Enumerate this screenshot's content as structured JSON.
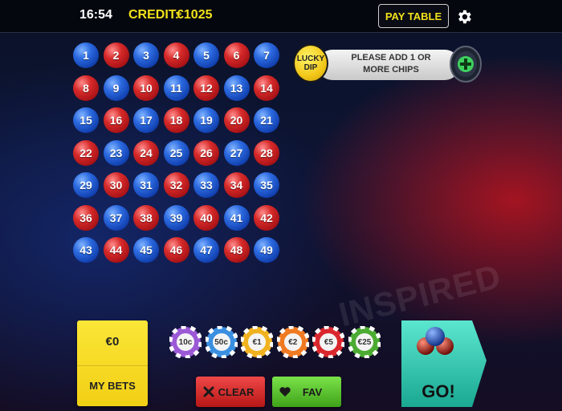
{
  "header": {
    "time": "16:54",
    "credit_label": "CREDIT:",
    "credit_value": "€1025",
    "paytable_label": "PAY TABLE",
    "settings_icon": "gear-icon"
  },
  "watermark": "INSPIRED",
  "colors": {
    "blue_ball": "#1f55cc",
    "red_ball": "#c81c1f",
    "accent_yellow": "#f2e21a",
    "clear_red": "#d92b2b",
    "fav_green": "#57c22d",
    "go_teal": "#2fc8b0"
  },
  "balls": [
    {
      "n": "1",
      "c": "blue"
    },
    {
      "n": "2",
      "c": "red"
    },
    {
      "n": "3",
      "c": "blue"
    },
    {
      "n": "4",
      "c": "red"
    },
    {
      "n": "5",
      "c": "blue"
    },
    {
      "n": "6",
      "c": "red"
    },
    {
      "n": "7",
      "c": "blue"
    },
    {
      "n": "8",
      "c": "red"
    },
    {
      "n": "9",
      "c": "blue"
    },
    {
      "n": "10",
      "c": "red"
    },
    {
      "n": "11",
      "c": "blue"
    },
    {
      "n": "12",
      "c": "red"
    },
    {
      "n": "13",
      "c": "blue"
    },
    {
      "n": "14",
      "c": "red"
    },
    {
      "n": "15",
      "c": "blue"
    },
    {
      "n": "16",
      "c": "red"
    },
    {
      "n": "17",
      "c": "blue"
    },
    {
      "n": "18",
      "c": "red"
    },
    {
      "n": "19",
      "c": "blue"
    },
    {
      "n": "20",
      "c": "red"
    },
    {
      "n": "21",
      "c": "blue"
    },
    {
      "n": "22",
      "c": "red"
    },
    {
      "n": "23",
      "c": "blue"
    },
    {
      "n": "24",
      "c": "red"
    },
    {
      "n": "25",
      "c": "blue"
    },
    {
      "n": "26",
      "c": "red"
    },
    {
      "n": "27",
      "c": "blue"
    },
    {
      "n": "28",
      "c": "red"
    },
    {
      "n": "29",
      "c": "blue"
    },
    {
      "n": "30",
      "c": "red"
    },
    {
      "n": "31",
      "c": "blue"
    },
    {
      "n": "32",
      "c": "red"
    },
    {
      "n": "33",
      "c": "blue"
    },
    {
      "n": "34",
      "c": "red"
    },
    {
      "n": "35",
      "c": "blue"
    },
    {
      "n": "36",
      "c": "red"
    },
    {
      "n": "37",
      "c": "blue"
    },
    {
      "n": "38",
      "c": "red"
    },
    {
      "n": "39",
      "c": "blue"
    },
    {
      "n": "40",
      "c": "red"
    },
    {
      "n": "41",
      "c": "blue"
    },
    {
      "n": "42",
      "c": "red"
    },
    {
      "n": "43",
      "c": "blue"
    },
    {
      "n": "44",
      "c": "red"
    },
    {
      "n": "45",
      "c": "blue"
    },
    {
      "n": "46",
      "c": "red"
    },
    {
      "n": "47",
      "c": "blue"
    },
    {
      "n": "48",
      "c": "red"
    },
    {
      "n": "49",
      "c": "blue"
    }
  ],
  "lucky_dip": {
    "badge_line1": "LUCKY",
    "badge_line2": "DIP",
    "message_line1": "PLEASE ADD 1 OR",
    "message_line2": "MORE CHIPS",
    "add_icon": "plus-chip-icon"
  },
  "bets": {
    "amount": "€0",
    "label": "MY BETS"
  },
  "chips": [
    {
      "label": "10c",
      "color": "#9b59d6"
    },
    {
      "label": "50c",
      "color": "#3a8fe0"
    },
    {
      "label": "€1",
      "color": "#f0b21f"
    },
    {
      "label": "€2",
      "color": "#f07a22"
    },
    {
      "label": "€5",
      "color": "#d9272d"
    },
    {
      "label": "€25",
      "color": "#4cab32"
    }
  ],
  "actions": {
    "clear_label": "CLEAR",
    "clear_icon": "x-icon",
    "fav_label": "FAV",
    "fav_icon": "heart-icon"
  },
  "go": {
    "label": "GO!",
    "icon": "balls-icon"
  }
}
